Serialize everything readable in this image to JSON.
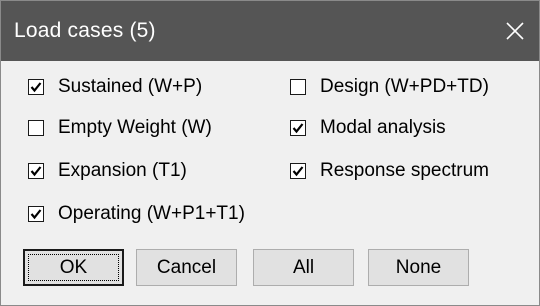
{
  "window": {
    "title": "Load cases (5)",
    "close_icon": "close-icon"
  },
  "load_cases": [
    {
      "label": "Sustained (W+P)",
      "checked": true
    },
    {
      "label": "Design (W+PD+TD)",
      "checked": false
    },
    {
      "label": "Empty Weight (W)",
      "checked": false
    },
    {
      "label": "Modal analysis",
      "checked": true
    },
    {
      "label": "Expansion (T1)",
      "checked": true
    },
    {
      "label": "Response spectrum",
      "checked": true
    },
    {
      "label": "Operating (W+P1+T1)",
      "checked": true
    }
  ],
  "buttons": {
    "ok": "OK",
    "cancel": "Cancel",
    "all": "All",
    "none": "None"
  },
  "colors": {
    "titlebar": "#555555",
    "dialog_bg": "#f0f0f0",
    "button_bg": "#e1e1e1"
  }
}
